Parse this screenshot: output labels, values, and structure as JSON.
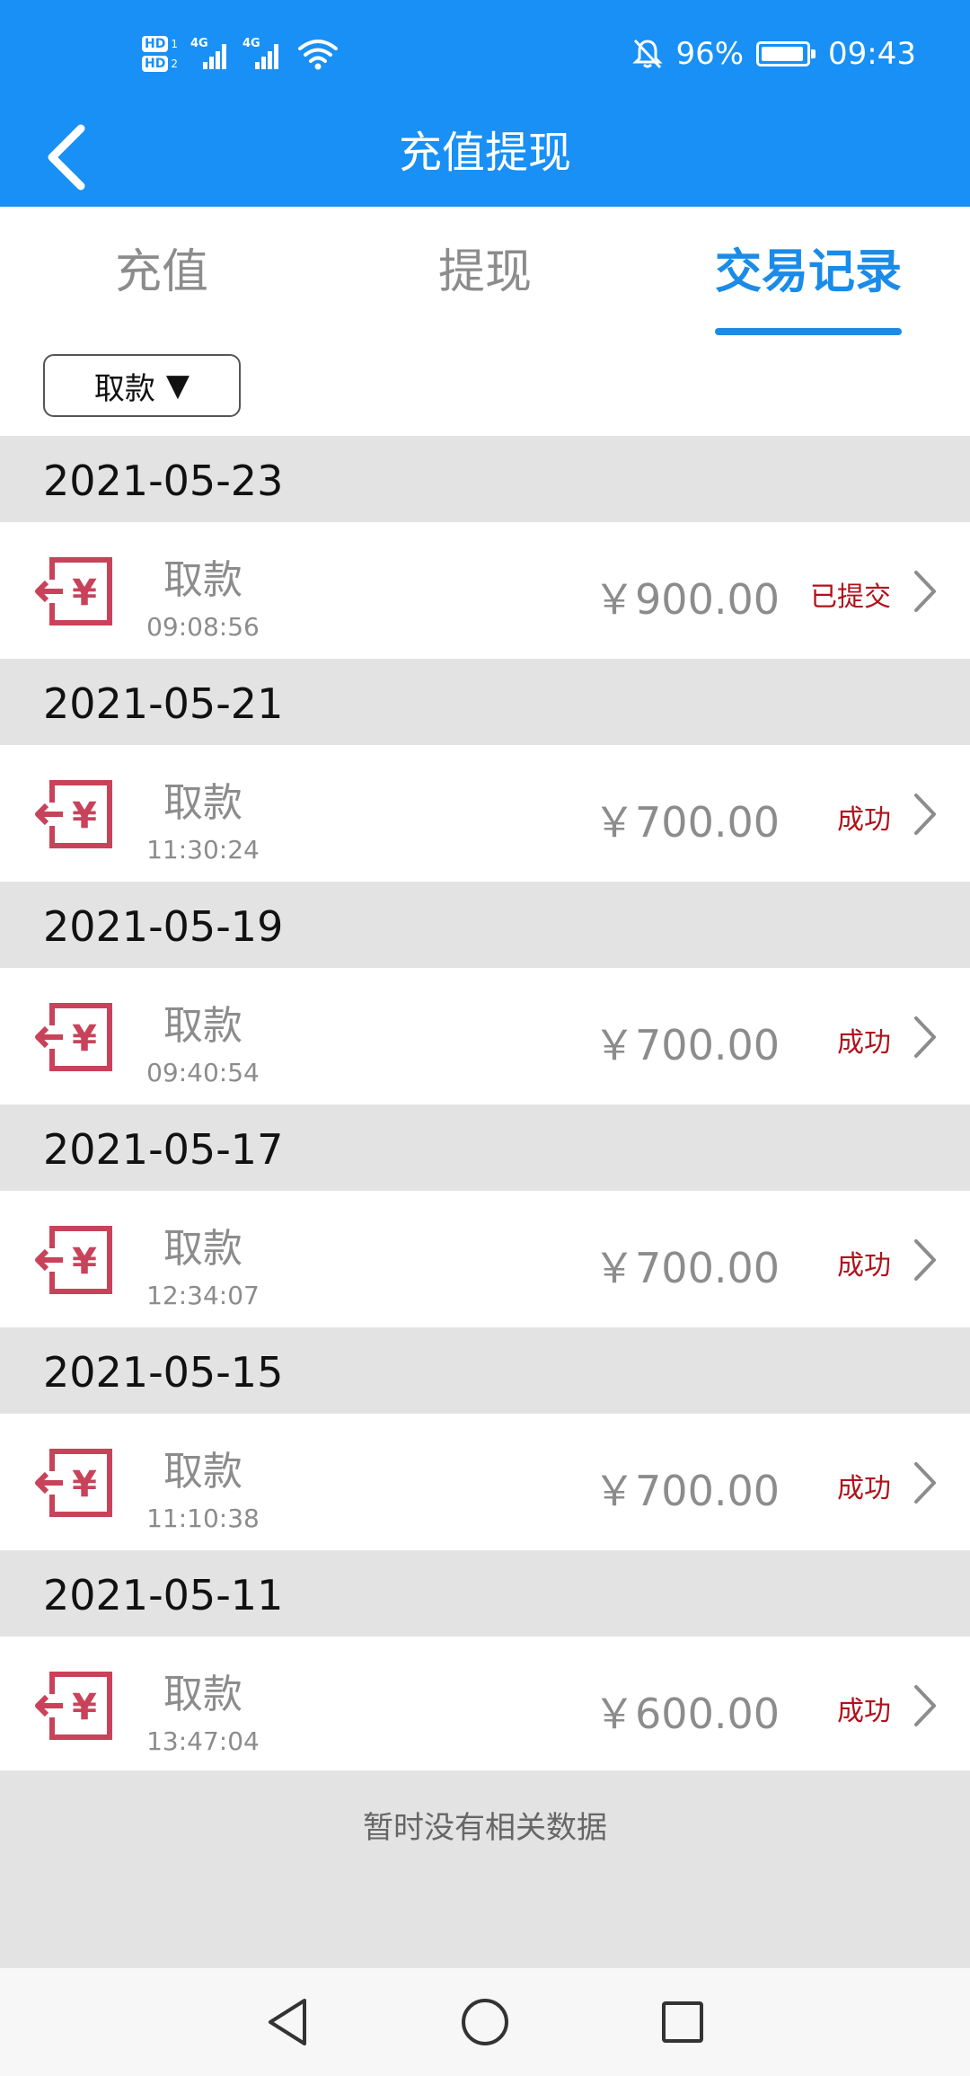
{
  "status_bar": {
    "hd1": "HD",
    "hd1_num": "1",
    "hd2": "HD",
    "hd2_num": "2",
    "network1": "4G",
    "network2": "4G",
    "battery_percent": "96%",
    "battery_level": 0.96,
    "time": "09:43",
    "icons": [
      "signal-icon",
      "wifi-icon",
      "mute-bell-icon",
      "battery-icon"
    ]
  },
  "header": {
    "title": "充值提现",
    "back_icon": "chevron-left-icon"
  },
  "tabs": [
    {
      "label": "充值",
      "active": false
    },
    {
      "label": "提现",
      "active": false
    },
    {
      "label": "交易记录",
      "active": true
    }
  ],
  "filter": {
    "label": "取款",
    "arrow": "▼"
  },
  "transactions": [
    {
      "date": "2021-05-23",
      "type": "取款",
      "time": "09:08:56",
      "amount": "￥900.00",
      "status": "已提交"
    },
    {
      "date": "2021-05-21",
      "type": "取款",
      "time": "11:30:24",
      "amount": "￥700.00",
      "status": "成功"
    },
    {
      "date": "2021-05-19",
      "type": "取款",
      "time": "09:40:54",
      "amount": "￥700.00",
      "status": "成功"
    },
    {
      "date": "2021-05-17",
      "type": "取款",
      "time": "12:34:07",
      "amount": "￥700.00",
      "status": "成功"
    },
    {
      "date": "2021-05-15",
      "type": "取款",
      "time": "11:10:38",
      "amount": "￥700.00",
      "status": "成功"
    },
    {
      "date": "2021-05-11",
      "type": "取款",
      "time": "13:47:04",
      "amount": "￥600.00",
      "status": "成功"
    }
  ],
  "empty_message": "暂时没有相关数据",
  "colors": {
    "primary": "#1890f5",
    "active_tab": "#1a8be8",
    "status_red": "#b0121b",
    "icon_red": "#c8435a",
    "date_bg": "#e3e3e3"
  }
}
